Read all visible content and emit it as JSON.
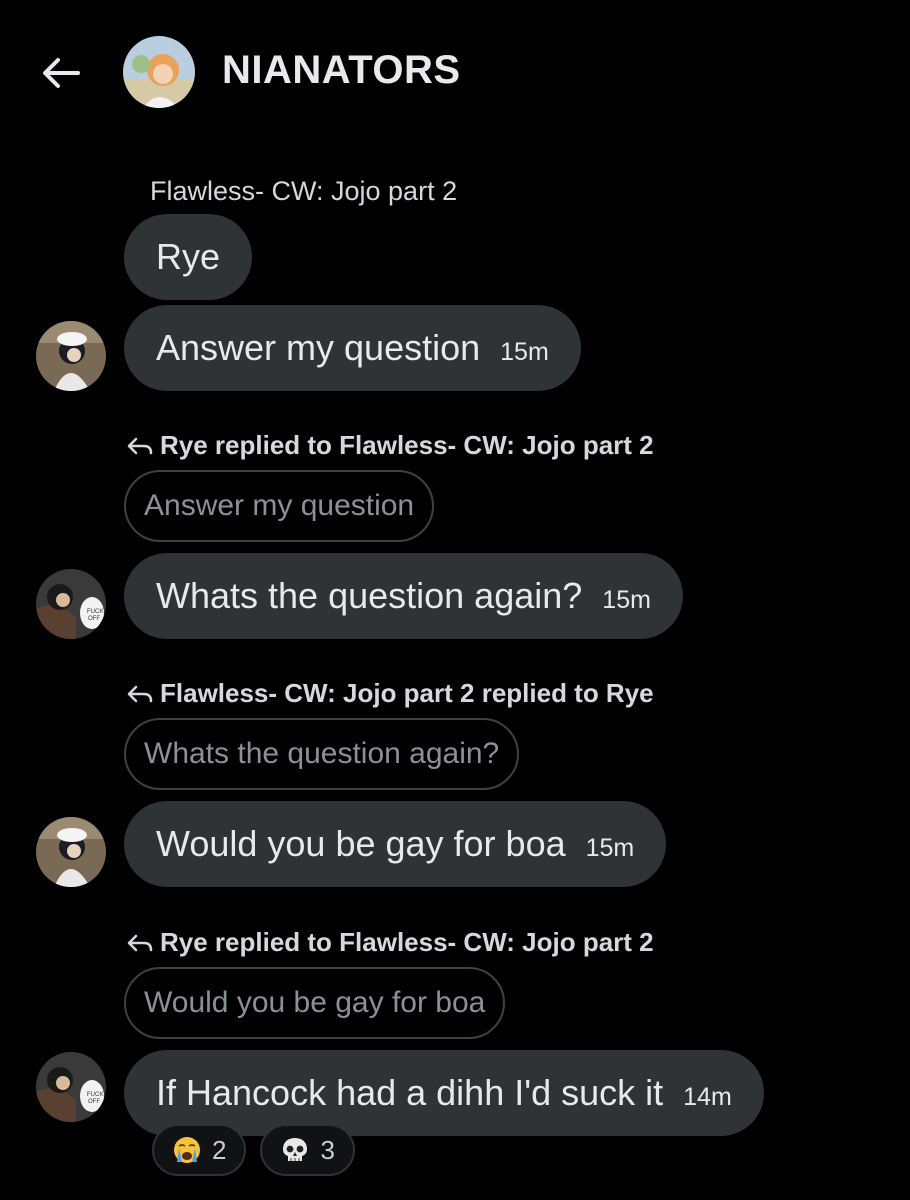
{
  "header": {
    "title": "NIANATORS",
    "back_icon": "arrow-left-icon",
    "avatar_icon": "group-avatar"
  },
  "conversation": {
    "first_sender": "Flawless- CW: Jojo part 2",
    "messages": [
      {
        "id": "m1",
        "text": "Rye",
        "time": ""
      },
      {
        "id": "m2",
        "text": "Answer my question",
        "time": "15m"
      },
      {
        "id": "m3",
        "reply_header": "Rye replied to Flawless- CW: Jojo part 2",
        "quote": "Answer my question",
        "text": "Whats the question again?",
        "time": "15m"
      },
      {
        "id": "m4",
        "reply_header": "Flawless- CW: Jojo part 2 replied to Rye",
        "quote": "Whats the question again?",
        "text": "Would you be gay for boa",
        "time": "15m"
      },
      {
        "id": "m5",
        "reply_header": "Rye replied to Flawless- CW: Jojo part 2",
        "quote": "Would you be gay for boa",
        "text": "If Hancock had a dihh I'd suck it",
        "time": "14m"
      }
    ],
    "reactions": [
      {
        "emoji": "crying-face-emoji",
        "count": "2"
      },
      {
        "emoji": "skull-emoji",
        "count": "3"
      }
    ]
  },
  "colors": {
    "background": "#000000",
    "bubble": "#2f3336",
    "text": "#e7e9ea",
    "muted": "#8b9196"
  }
}
